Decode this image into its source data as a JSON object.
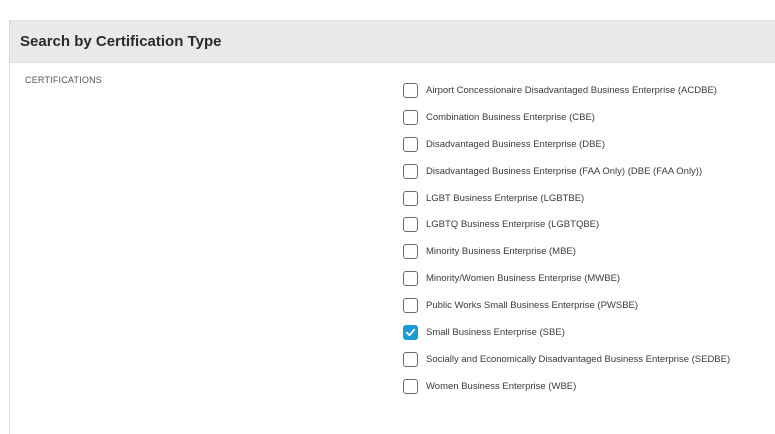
{
  "section": {
    "title": "Search by Certification Type"
  },
  "field": {
    "label": "CERTIFICATIONS"
  },
  "certifications": [
    {
      "label": "Airport Concessionaire Disadvantaged Business Enterprise (ACDBE)",
      "checked": false
    },
    {
      "label": "Combination Business Enterprise (CBE)",
      "checked": false
    },
    {
      "label": "Disadvantaged Business Enterprise (DBE)",
      "checked": false
    },
    {
      "label": "Disadvantaged Business Enterprise (FAA Only) (DBE (FAA Only))",
      "checked": false
    },
    {
      "label": "LGBT Business Enterprise (LGBTBE)",
      "checked": false
    },
    {
      "label": "LGBTQ Business Enterprise (LGBTQBE)",
      "checked": false
    },
    {
      "label": "Minority Business Enterprise (MBE)",
      "checked": false
    },
    {
      "label": "Minority/Women Business Enterprise (MWBE)",
      "checked": false
    },
    {
      "label": "Public Works Small Business Enterprise (PWSBE)",
      "checked": false
    },
    {
      "label": "Small Business Enterprise (SBE)",
      "checked": true
    },
    {
      "label": "Socially and Economically Disadvantaged Business Enterprise (SEDBE)",
      "checked": false
    },
    {
      "label": "Women Business Enterprise (WBE)",
      "checked": false
    }
  ],
  "colors": {
    "checked_fill": "#1a9bd7",
    "header_bg": "#e9e9e9"
  },
  "icons": {
    "check": "check-icon"
  }
}
